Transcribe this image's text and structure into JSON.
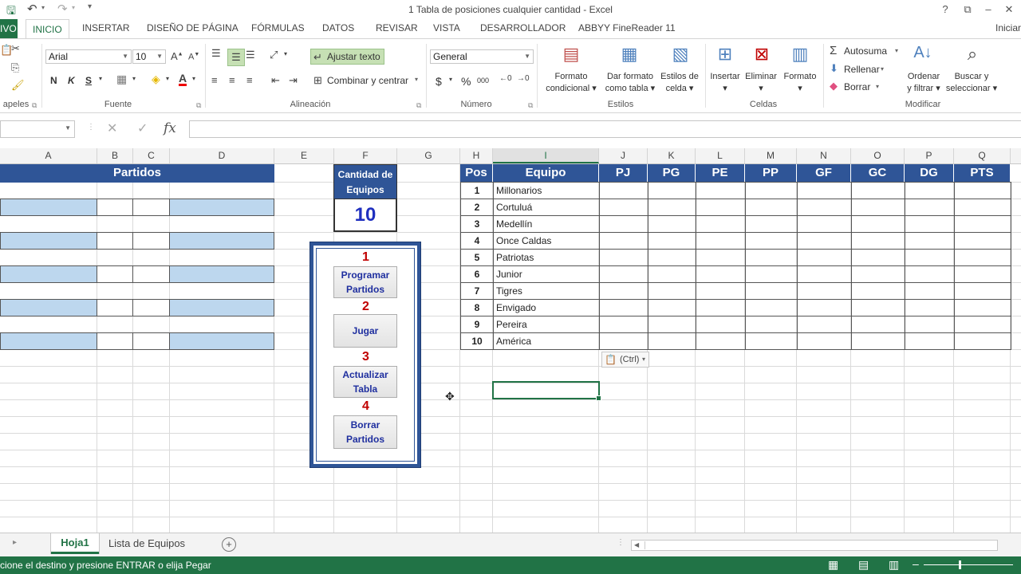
{
  "window": {
    "title": "1 Tabla de posiciones cualquier cantidad - Excel",
    "help": "?",
    "minimize": "–",
    "close": "✕",
    "signin": "Iniciar"
  },
  "tabs": {
    "file": "IVO",
    "items": [
      "INICIO",
      "INSERTAR",
      "DISEÑO DE PÁGINA",
      "FÓRMULAS",
      "DATOS",
      "REVISAR",
      "VISTA",
      "DESARROLLADOR",
      "ABBYY FineReader 11"
    ]
  },
  "ribbon": {
    "clipboard_label": "apeles",
    "font_label": "Fuente",
    "alignment_label": "Alineación",
    "number_label": "Número",
    "styles_label": "Estilos",
    "cells_label": "Celdas",
    "modify_label": "Modificar",
    "font_name": "Arial",
    "font_size": "10",
    "bold": "N",
    "italic": "K",
    "underline": "S",
    "wrap_text": "Ajustar texto",
    "merge_center": "Combinar y centrar",
    "number_format": "General",
    "currency": "$",
    "percent": "%",
    "thousands": "000",
    "cond_format_1": "Formato",
    "cond_format_2": "condicional",
    "table_format_1": "Dar formato",
    "table_format_2": "como tabla",
    "cell_styles_1": "Estilos de",
    "cell_styles_2": "celda",
    "insert": "Insertar",
    "delete": "Eliminar",
    "format": "Formato",
    "autosum": "Autosuma",
    "fill": "Rellenar",
    "clear": "Borrar",
    "sort_1": "Ordenar",
    "sort_2": "y filtrar",
    "find_1": "Buscar y",
    "find_2": "seleccionar"
  },
  "formula_bar": {
    "cancel": "✕",
    "enter": "✓",
    "fx": "fx",
    "value": ""
  },
  "columns": [
    "A",
    "B",
    "C",
    "D",
    "E",
    "F",
    "G",
    "H",
    "I",
    "J",
    "K",
    "L",
    "M",
    "N",
    "O",
    "P",
    "Q"
  ],
  "sheet": {
    "partidos_header": "Partidos",
    "cantidad_label_1": "Cantidad de",
    "cantidad_label_2": "Equipos",
    "cantidad_value": "10",
    "steps": [
      {
        "num": "1",
        "label_1": "Programar",
        "label_2": "Partidos"
      },
      {
        "num": "2",
        "label_1": "Jugar",
        "label_2": ""
      },
      {
        "num": "3",
        "label_1": "Actualizar",
        "label_2": "Tabla"
      },
      {
        "num": "4",
        "label_1": "Borrar",
        "label_2": "Partidos"
      }
    ],
    "table_headers": [
      "Pos",
      "Equipo",
      "PJ",
      "PG",
      "PE",
      "PP",
      "GF",
      "GC",
      "DG",
      "PTS"
    ],
    "teams": [
      {
        "pos": "1",
        "name": "Millonarios"
      },
      {
        "pos": "2",
        "name": "Cortuluá"
      },
      {
        "pos": "3",
        "name": "Medellín"
      },
      {
        "pos": "4",
        "name": "Once Caldas"
      },
      {
        "pos": "5",
        "name": "Patriotas"
      },
      {
        "pos": "6",
        "name": "Junior"
      },
      {
        "pos": "7",
        "name": "Tigres"
      },
      {
        "pos": "8",
        "name": "Envigado"
      },
      {
        "pos": "9",
        "name": "Pereira"
      },
      {
        "pos": "10",
        "name": "América"
      }
    ],
    "paste_options": "(Ctrl)"
  },
  "sheet_tabs": {
    "active": "Hoja1",
    "other": "Lista de Equipos",
    "add": "+"
  },
  "status": {
    "message": "cione el destino y presione ENTRAR o elija Pegar"
  }
}
